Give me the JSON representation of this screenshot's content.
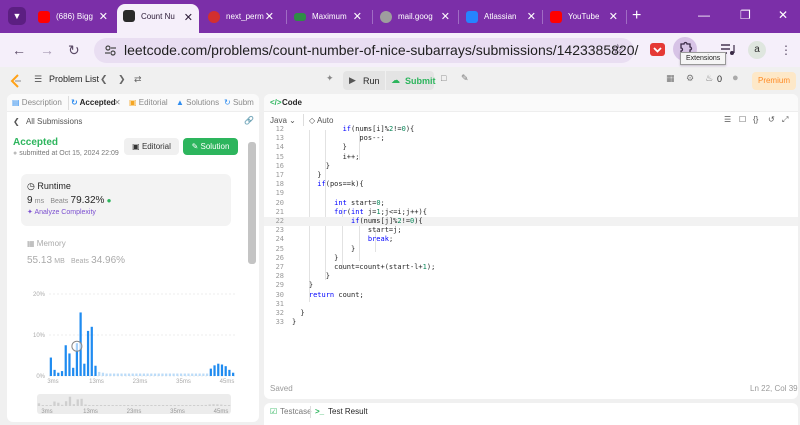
{
  "browser": {
    "tabs": [
      {
        "label": "(686) Bigg",
        "favicon": "youtube-icon",
        "active": false
      },
      {
        "label": "Count Nu",
        "favicon": "leetcode-icon",
        "active": true
      },
      {
        "label": "next_perm",
        "favicon": "tuf-icon",
        "active": false
      },
      {
        "label": "Maximum",
        "favicon": "gfg-icon",
        "active": false
      },
      {
        "label": "mail.goog",
        "favicon": "globe-icon",
        "active": false
      },
      {
        "label": "Atlassian",
        "favicon": "atlassian-icon",
        "active": false
      },
      {
        "label": "YouTube",
        "favicon": "youtube-icon",
        "active": false
      }
    ],
    "url": "leetcode.com/problems/count-number-of-nice-subarrays/submissions/1423385820/",
    "extensions_tooltip": "Extensions",
    "profile_initial": "a",
    "colors": {
      "frame": "#7b2fa8",
      "toolbar": "#f5effa",
      "omnibox": "#e9def2"
    }
  },
  "lc_nav": {
    "problem_list": "Problem List",
    "run": "Run",
    "submit": "Submit",
    "fire_count": "0",
    "premium": "Premium"
  },
  "left_panel": {
    "tabs": {
      "description": "Description",
      "accepted": "Accepted",
      "editorial": "Editorial",
      "solutions": "Solutions",
      "submissions": "Subm"
    },
    "back_link": "All Submissions",
    "status": "Accepted",
    "submitted": "submitted at Oct 15, 2024 22:09",
    "editorial_btn": "Editorial",
    "solution_btn": "Solution",
    "runtime": {
      "label": "Runtime",
      "value": "9",
      "unit": "ms",
      "beats_label": "Beats",
      "beats": "79.32%",
      "analyze": "Analyze Complexity"
    },
    "memory": {
      "label": "Memory",
      "value": "55.13",
      "unit": "MB",
      "beats_label": "Beats",
      "beats": "34.96%"
    }
  },
  "chart_data": {
    "type": "bar",
    "y_ticks": [
      "20%",
      "10%",
      "0%"
    ],
    "ylim": [
      0,
      20
    ],
    "x_ticks": [
      "3ms",
      "13ms",
      "23ms",
      "35ms",
      "45ms"
    ],
    "mini_x_ticks": [
      "3ms",
      "13ms",
      "23ms",
      "35ms",
      "45ms"
    ],
    "values": [
      4.5,
      1.5,
      0.8,
      1.2,
      7.5,
      5.5,
      2,
      8,
      15.5,
      3,
      11,
      12,
      2.5,
      1,
      0.8,
      0.6,
      0.6,
      0.6,
      0.6,
      0.6,
      0.6,
      0.6,
      0.6,
      0.6,
      0.6,
      0.6,
      0.6,
      0.6,
      0.6,
      0.6,
      0.6,
      0.6,
      0.6,
      0.6,
      0.6,
      0.6,
      0.6,
      0.6,
      0.6,
      0.6,
      0.6,
      0.6,
      0.6,
      1.8,
      2.6,
      3,
      2.8,
      2.4,
      1.5,
      0.8
    ],
    "highlight_index": 7,
    "bar_color": "#1f8bf0",
    "bar_color_light": "#bcdcf8"
  },
  "editor": {
    "title": "Code",
    "language": "Java",
    "mode": "Auto",
    "status_left": "Saved",
    "status_right": "Ln 22, Col 39",
    "lines": [
      {
        "n": "12",
        "code": "            if(nums[i]%2!=0){"
      },
      {
        "n": "13",
        "code": "                pos--;"
      },
      {
        "n": "14",
        "code": "            }"
      },
      {
        "n": "15",
        "code": "            i++;"
      },
      {
        "n": "16",
        "code": "        }"
      },
      {
        "n": "17",
        "code": "      }"
      },
      {
        "n": "18",
        "code": "      if(pos==k){"
      },
      {
        "n": "19",
        "code": ""
      },
      {
        "n": "20",
        "code": "          int start=0;"
      },
      {
        "n": "21",
        "code": "          for(int j=1;j<=i;j++){"
      },
      {
        "n": "22",
        "code": "              if(nums[j]%2!=0){"
      },
      {
        "n": "23",
        "code": "                  start=j;"
      },
      {
        "n": "24",
        "code": "                  break;"
      },
      {
        "n": "25",
        "code": "              }"
      },
      {
        "n": "26",
        "code": "          }"
      },
      {
        "n": "27",
        "code": "          count=count+(start-l+1);"
      },
      {
        "n": "28",
        "code": "        }"
      },
      {
        "n": "29",
        "code": "    }"
      },
      {
        "n": "30",
        "code": "    return count;"
      },
      {
        "n": "31",
        "code": ""
      },
      {
        "n": "32",
        "code": "  }"
      },
      {
        "n": "33",
        "code": "}"
      }
    ]
  },
  "bottom_panel": {
    "testcase": "Testcase",
    "test_result": "Test Result"
  }
}
